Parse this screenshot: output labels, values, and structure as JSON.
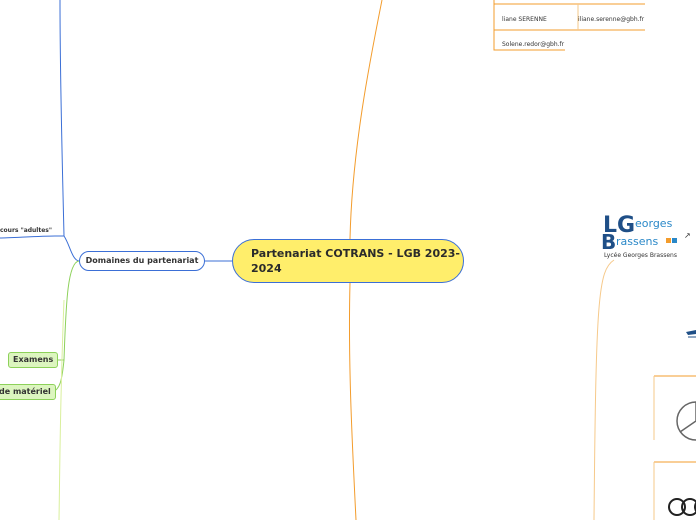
{
  "central": {
    "title": "Partenariat COTRANS - LGB 2023-2024"
  },
  "domains": {
    "label": "Domaines du partenariat"
  },
  "left_items": {
    "parcours": "cours \"adultes\"",
    "examens": "Examens",
    "materiel": "de matériel"
  },
  "contacts": [
    {
      "name": "liane SERENNE",
      "email": "iliane.serenne@gbh.fr"
    },
    {
      "name": "Solene.redor@gbh.fr",
      "email": ""
    }
  ],
  "logo": {
    "caption": "Lycée Georges Brassens",
    "letters_l": "L",
    "letters_g": "G",
    "letters_b": "B",
    "word_eorges": "eorges",
    "word_rassens": "rassens",
    "link_icon": "external-link-icon"
  },
  "colors": {
    "central_fill": "#ffee6b",
    "blue_line": "#3b6fd6",
    "orange_line": "#f39c2c",
    "green_fill": "#dcf5bf",
    "green_border": "#8dd15a",
    "logo_blue": "#1f4f87"
  }
}
